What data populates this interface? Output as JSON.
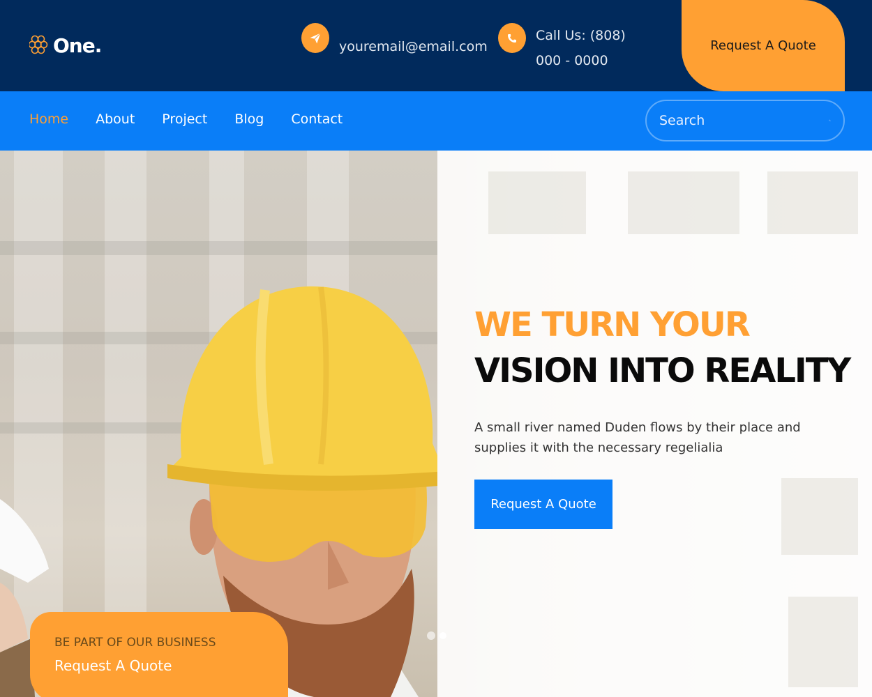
{
  "brand": {
    "name": "One."
  },
  "contact": {
    "email": "youremail@email.com",
    "phone": "Call Us: (808) 000 - 0000"
  },
  "header": {
    "quote_label": "Request A Quote"
  },
  "nav": {
    "items": [
      {
        "label": "Home",
        "active": true
      },
      {
        "label": "About",
        "active": false
      },
      {
        "label": "Project",
        "active": false
      },
      {
        "label": "Blog",
        "active": false
      },
      {
        "label": "Contact",
        "active": false
      }
    ],
    "search_placeholder": "Search"
  },
  "hero": {
    "title_line_1": "WE TURN YOUR",
    "title_line_2": "VISION INTO REALITY",
    "description": "A small river named Duden flows by their place and supplies it with the necessary regelialia",
    "cta_label": "Request A Quote"
  },
  "slider": {
    "count": 2,
    "active_index": 1
  },
  "bottom_card": {
    "kicker": "BE PART OF OUR BUSINESS",
    "link_label": "Request A Quote"
  },
  "colors": {
    "navy": "#012a5c",
    "blue": "#0a7ef8",
    "orange": "#ffa033"
  },
  "icons": [
    "honeycomb-logo-icon",
    "paper-plane-icon",
    "phone-icon",
    "search-icon"
  ]
}
